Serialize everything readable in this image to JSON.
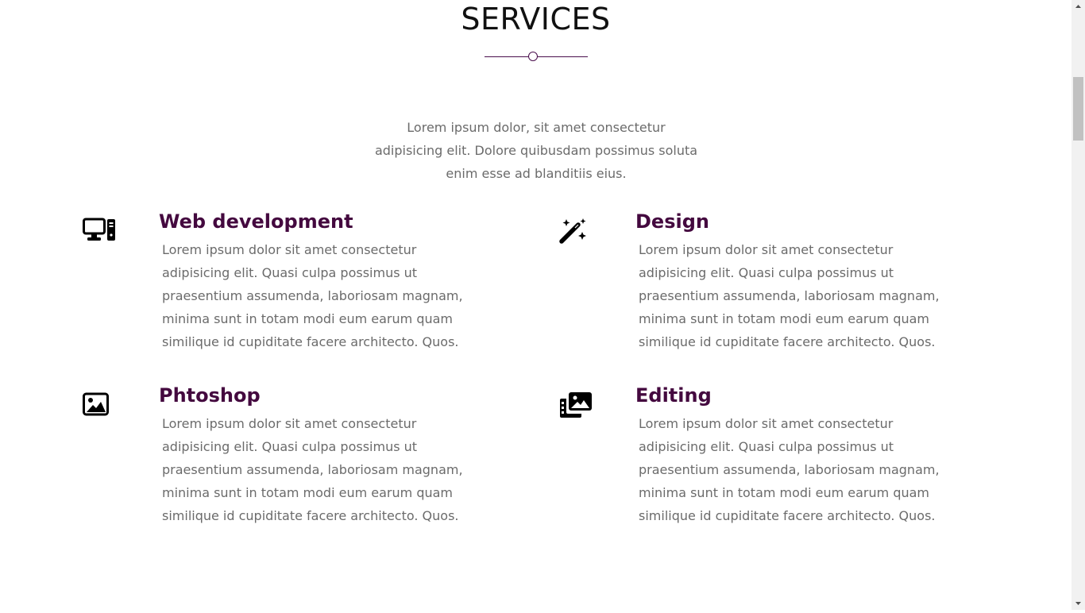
{
  "section": {
    "title": "SERVICES",
    "intro": "Lorem ipsum dolor, sit amet consectetur adipisicing elit. Dolore quibusdam possimus soluta enim esse ad blanditiis eius."
  },
  "theme": {
    "accent": "#44093f",
    "text": "#6b6b6b",
    "heading": "#111111"
  },
  "services": [
    {
      "icon": "desktop-computer-icon",
      "title": "Web development",
      "description": "Lorem ipsum dolor sit amet consectetur adipisicing elit. Quasi culpa possimus ut praesentium assumenda, laboriosam magnam, minima sunt in totam modi eum earum quam similique id cupiditate facere architecto. Quos."
    },
    {
      "icon": "magic-wand-sparkles-icon",
      "title": "Design",
      "description": "Lorem ipsum dolor sit amet consectetur adipisicing elit. Quasi culpa possimus ut praesentium assumenda, laboriosam magnam, minima sunt in totam modi eum earum quam similique id cupiditate facere architecto. Quos."
    },
    {
      "icon": "image-icon",
      "title": "Phtoshop",
      "description": "Lorem ipsum dolor sit amet consectetur adipisicing elit. Quasi culpa possimus ut praesentium assumenda, laboriosam magnam, minima sunt in totam modi eum earum quam similique id cupiditate facere architecto. Quos."
    },
    {
      "icon": "photo-film-icon",
      "title": "Editing",
      "description": "Lorem ipsum dolor sit amet consectetur adipisicing elit. Quasi culpa possimus ut praesentium assumenda, laboriosam magnam, minima sunt in totam modi eum earum quam similique id cupiditate facere architecto. Quos."
    }
  ]
}
